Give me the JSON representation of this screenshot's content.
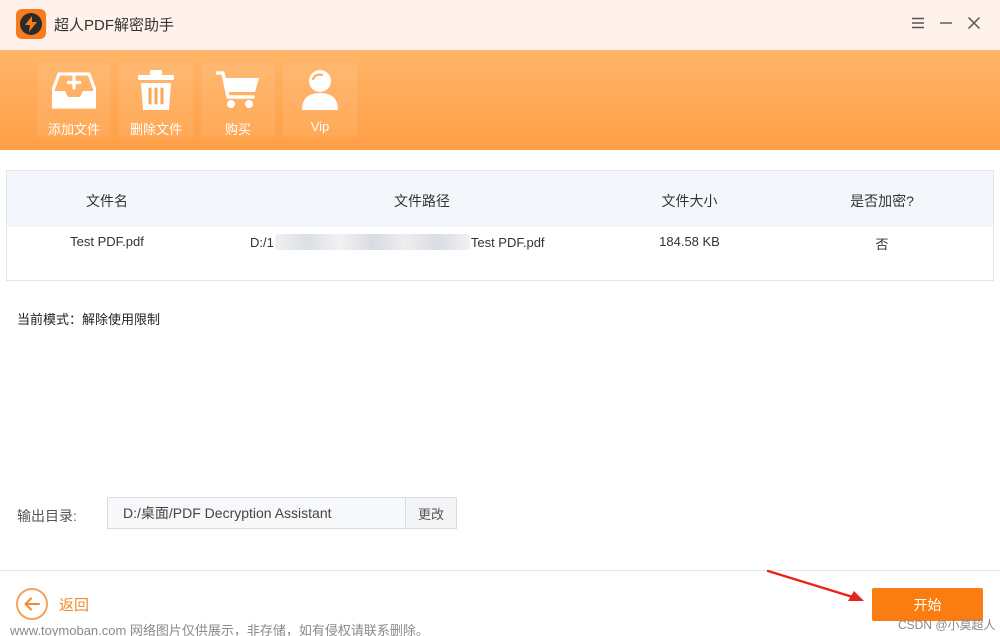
{
  "window": {
    "title": "超人PDF解密助手",
    "controls": [
      "menu-icon",
      "minimize-icon",
      "close-icon"
    ]
  },
  "toolbar": {
    "items": [
      {
        "label": "添加文件",
        "icon": "add-file-icon"
      },
      {
        "label": "删除文件",
        "icon": "trash-icon"
      },
      {
        "label": "购买",
        "icon": "cart-icon"
      },
      {
        "label": "Vip",
        "icon": "user-icon"
      }
    ]
  },
  "table": {
    "headers": [
      "文件名",
      "文件路径",
      "文件大小",
      "是否加密?"
    ],
    "rows": [
      {
        "name": "Test PDF.pdf",
        "path_prefix": "D:/1",
        "path_suffix": "Test PDF.pdf",
        "size": "184.58 KB",
        "encrypted": "否"
      }
    ]
  },
  "mode": {
    "text": "当前模式：解除使用限制"
  },
  "output": {
    "label": "输出目录:",
    "value": "D:/桌面/PDF Decryption Assistant",
    "change_label": "更改"
  },
  "footer": {
    "back_label": "返回",
    "start_label": "开始"
  },
  "watermark": {
    "text": "www.toymoban.com 网络图片仅供展示，非存储，如有侵权请联系删除。",
    "credit": "CSDN @小莫超人"
  },
  "colors": {
    "accent": "#fb7d12",
    "toolbar": "#ffa550",
    "annotation_arrow": "#e8241a"
  }
}
